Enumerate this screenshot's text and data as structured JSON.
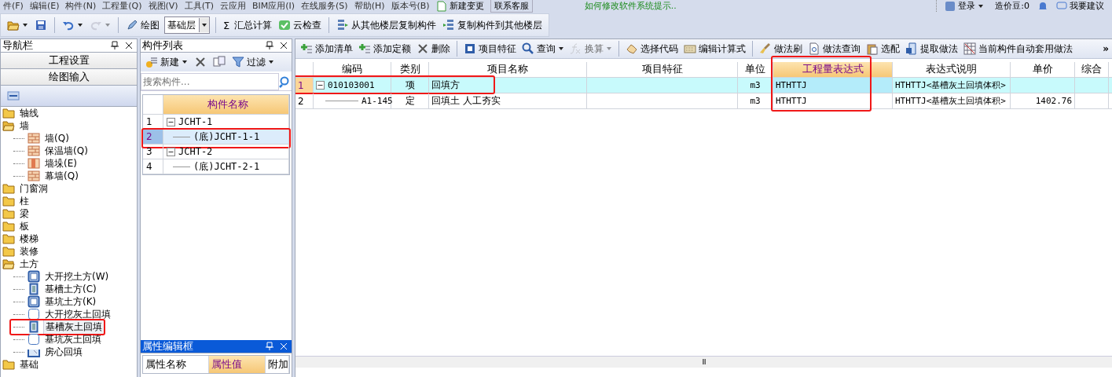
{
  "menu": [
    "件(F)",
    "编辑(E)",
    "构件(N)",
    "工程量(Q)",
    "视图(V)",
    "工具(T)",
    "云应用",
    "BIM应用(I)",
    "在线服务(S)",
    "帮助(H)",
    "版本号(B)"
  ],
  "menu_extras": {
    "new_change": "新建变更",
    "contact": "联系客服",
    "hint": "如何修改软件系统提示..",
    "login": "登录",
    "beans": "造价豆:0",
    "suggest": "我要建议"
  },
  "toolbar": [
    {
      "kind": "icon",
      "dropdown": true,
      "disabled": false
    },
    {
      "kind": "icon",
      "dropdown": false,
      "disabled": false
    },
    {
      "kind": "separator"
    },
    {
      "kind": "icon",
      "dropdown": true,
      "disabled": false
    },
    {
      "kind": "icon",
      "dropdown": true,
      "disabled": true
    },
    {
      "kind": "separator"
    },
    {
      "kind": "button",
      "label": "绘图",
      "dropdown": false,
      "disabled": false
    },
    {
      "kind": "select",
      "value": "基础层"
    },
    {
      "kind": "separator"
    },
    {
      "kind": "glyph",
      "glyph": "Σ",
      "label": "汇总计算",
      "dropdown": false,
      "disabled": false
    },
    {
      "kind": "button",
      "label": "云检查",
      "dropdown": false,
      "disabled": false
    },
    {
      "kind": "separator"
    },
    {
      "kind": "button",
      "label": "从其他楼层复制构件",
      "dropdown": false,
      "disabled": false
    },
    {
      "kind": "button",
      "label": "复制构件到其他楼层",
      "dropdown": false,
      "disabled": false
    }
  ],
  "nav_panel": {
    "title": "导航栏",
    "sections": [
      "工程设置",
      "绘图输入"
    ],
    "tree": [
      {
        "label": "轴线",
        "kind": "folder",
        "expanded": false,
        "selected": false,
        "annotated": false
      },
      {
        "label": "墙",
        "kind": "folder",
        "expanded": true,
        "selected": false,
        "annotated": false,
        "children": [
          {
            "label": "墙(Q)",
            "kind": "brick",
            "selected": false,
            "annotated": false
          },
          {
            "label": "保温墙(Q)",
            "kind": "brick",
            "selected": false,
            "annotated": false
          },
          {
            "label": "墙垛(E)",
            "kind": "pier",
            "selected": false,
            "annotated": false
          },
          {
            "label": "幕墙(Q)",
            "kind": "brick",
            "selected": false,
            "annotated": false
          }
        ]
      },
      {
        "label": "门窗洞",
        "kind": "folder",
        "expanded": false,
        "selected": false,
        "annotated": false
      },
      {
        "label": "柱",
        "kind": "folder",
        "expanded": false,
        "selected": false,
        "annotated": false
      },
      {
        "label": "梁",
        "kind": "folder",
        "expanded": false,
        "selected": false,
        "annotated": false
      },
      {
        "label": "板",
        "kind": "folder",
        "expanded": false,
        "selected": false,
        "annotated": false
      },
      {
        "label": "楼梯",
        "kind": "folder",
        "expanded": false,
        "selected": false,
        "annotated": false
      },
      {
        "label": "装修",
        "kind": "folder",
        "expanded": false,
        "selected": false,
        "annotated": false
      },
      {
        "label": "土方",
        "kind": "folder",
        "expanded": true,
        "selected": false,
        "annotated": false,
        "children": [
          {
            "label": "大开挖土方(W)",
            "kind": "pit",
            "selected": false,
            "annotated": false
          },
          {
            "label": "基槽土方(C)",
            "kind": "trench",
            "selected": false,
            "annotated": false
          },
          {
            "label": "基坑土方(K)",
            "kind": "pit",
            "selected": false,
            "annotated": false
          },
          {
            "label": "大开挖灰土回填",
            "kind": "fill",
            "selected": false,
            "annotated": false
          },
          {
            "label": "基槽灰土回填",
            "kind": "trench",
            "selected": true,
            "annotated": true
          },
          {
            "label": "基坑灰土回填",
            "kind": "fill",
            "selected": false,
            "annotated": false
          },
          {
            "label": "房心回填",
            "kind": "room",
            "selected": false,
            "annotated": false
          }
        ]
      },
      {
        "label": "基础",
        "kind": "folder",
        "expanded": false,
        "selected": false,
        "annotated": false
      }
    ]
  },
  "component_panel": {
    "title": "构件列表",
    "toolbar": [
      {
        "kind": "button",
        "label": "新建",
        "dropdown": true
      },
      {
        "kind": "icon",
        "dropdown": false
      },
      {
        "kind": "icon",
        "dropdown": false
      },
      {
        "kind": "button",
        "label": "过滤",
        "dropdown": true
      }
    ],
    "search": {
      "placeholder": "搜索构件..."
    },
    "column": {
      "label": "构件名称",
      "selected": true
    },
    "rows": [
      {
        "num": "1",
        "name": "JCHT-1",
        "expanded": true,
        "selected": false,
        "annotated": false,
        "children": [
          {
            "num": "2",
            "name": "(底)JCHT-1-1",
            "selected": true,
            "annotated": true
          }
        ]
      },
      {
        "num": "3",
        "name": "JCHT-2",
        "expanded": true,
        "selected": false,
        "annotated": false,
        "children": [
          {
            "num": "4",
            "name": "(底)JCHT-2-1",
            "selected": false,
            "annotated": false
          }
        ]
      }
    ]
  },
  "property_panel": {
    "title": "属性编辑框",
    "columns": [
      {
        "label": "属性名称",
        "selected": false
      },
      {
        "label": "属性值",
        "selected": true
      },
      {
        "label": "附加",
        "selected": false
      }
    ]
  },
  "main_toolbar": {
    "items": [
      {
        "kind": "button",
        "label": "添加清单",
        "dropdown": false,
        "disabled": false
      },
      {
        "kind": "button",
        "label": "添加定额",
        "dropdown": false,
        "disabled": false
      },
      {
        "kind": "button",
        "label": "删除",
        "dropdown": false,
        "disabled": false
      },
      {
        "kind": "separator"
      },
      {
        "kind": "button",
        "label": "项目特征",
        "dropdown": false,
        "disabled": false
      },
      {
        "kind": "button",
        "label": "查询",
        "dropdown": true,
        "disabled": false
      },
      {
        "kind": "button",
        "label": "换算",
        "dropdown": true,
        "disabled": true
      },
      {
        "kind": "separator"
      },
      {
        "kind": "button",
        "label": "选择代码",
        "dropdown": false,
        "disabled": false
      },
      {
        "kind": "button",
        "label": "编辑计算式",
        "dropdown": false,
        "disabled": false
      },
      {
        "kind": "separator"
      },
      {
        "kind": "button",
        "label": "做法刷",
        "dropdown": false,
        "disabled": false
      },
      {
        "kind": "button",
        "label": "做法查询",
        "dropdown": false,
        "disabled": false
      },
      {
        "kind": "button",
        "label": "选配",
        "dropdown": false,
        "disabled": false
      },
      {
        "kind": "button",
        "label": "提取做法",
        "dropdown": false,
        "disabled": false
      },
      {
        "kind": "button",
        "label": "当前构件自动套用做法",
        "dropdown": false,
        "disabled": false
      }
    ],
    "more": "»"
  },
  "table": {
    "columns": [
      {
        "label": "编码",
        "selected": false,
        "annotated": false
      },
      {
        "label": "类别",
        "selected": false,
        "annotated": false
      },
      {
        "label": "项目名称",
        "selected": false,
        "annotated": false
      },
      {
        "label": "项目特征",
        "selected": false,
        "annotated": false
      },
      {
        "label": "单位",
        "selected": false,
        "annotated": false
      },
      {
        "label": "工程量表达式",
        "selected": true,
        "annotated": true
      },
      {
        "label": "表达式说明",
        "selected": false,
        "annotated": false
      },
      {
        "label": "单价",
        "selected": false,
        "annotated": false
      },
      {
        "label": "综合",
        "selected": false,
        "annotated": false
      }
    ],
    "rows": [
      {
        "num": "1",
        "code": "010103001",
        "type": "项",
        "name": "回填方",
        "unit": "m3",
        "expression": "HTHTTJ",
        "expression_note": "HTHTTJ<基槽灰土回填体积>",
        "selected": true,
        "annotated": true,
        "expanded": true,
        "children": [
          {
            "num": "2",
            "code": "A1-145",
            "type": "定",
            "name": "回填土 人工夯实",
            "unit": "m3",
            "expression": "HTHTTJ",
            "expression_note": "HTHTTJ<基槽灰土回填体积>",
            "unit_price": "1402.76",
            "selected": false,
            "annotated": false
          }
        ]
      }
    ],
    "scrollbar_grip": "III"
  }
}
